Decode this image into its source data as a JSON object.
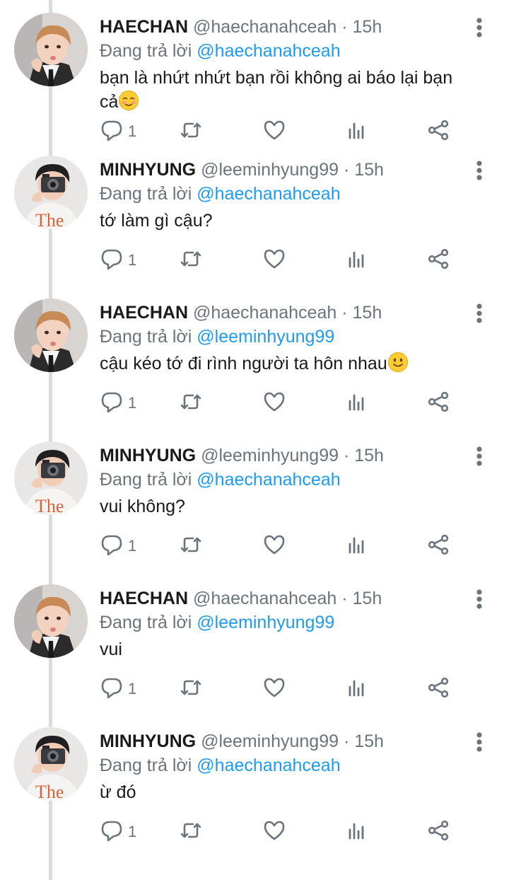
{
  "colors": {
    "link": "#1d9bf0",
    "muted": "#6b747c",
    "thread_line": "#d9dde1"
  },
  "reply_prefix": "Đang trả lời",
  "tweets": [
    {
      "name": "HAECHAN",
      "handle": "@haechanahceah",
      "time": "· 15h",
      "reply_to": "@haechanahceah",
      "text": "bạn là nhứt nhứt bạn rồi không ai báo lại bạn cả",
      "emoji": "relieved-face",
      "reply_count": "1",
      "avatar": "haechan-avatar"
    },
    {
      "name": "MINHYUNG",
      "handle": "@leeminhyung99",
      "time": "· 15h",
      "reply_to": "@haechanahceah",
      "text": "tớ làm gì cậu?",
      "emoji": "",
      "reply_count": "1",
      "avatar": "minhyung-avatar"
    },
    {
      "name": "HAECHAN",
      "handle": "@haechanahceah",
      "time": "· 15h",
      "reply_to": "@leeminhyung99",
      "text": "cậu kéo tớ đi rình người ta hôn nhau",
      "emoji": "slightly-smiling-face",
      "reply_count": "1",
      "avatar": "haechan-avatar"
    },
    {
      "name": "MINHYUNG",
      "handle": "@leeminhyung99",
      "time": "· 15h",
      "reply_to": "@haechanahceah",
      "text": "vui không?",
      "emoji": "",
      "reply_count": "1",
      "avatar": "minhyung-avatar"
    },
    {
      "name": "HAECHAN",
      "handle": "@haechanahceah",
      "time": "· 15h",
      "reply_to": "@leeminhyung99",
      "text": "vui",
      "emoji": "",
      "reply_count": "1",
      "avatar": "haechan-avatar"
    },
    {
      "name": "MINHYUNG",
      "handle": "@leeminhyung99",
      "time": "· 15h",
      "reply_to": "@haechanahceah",
      "text": "ừ đó",
      "emoji": "",
      "reply_count": "1",
      "avatar": "minhyung-avatar"
    }
  ]
}
